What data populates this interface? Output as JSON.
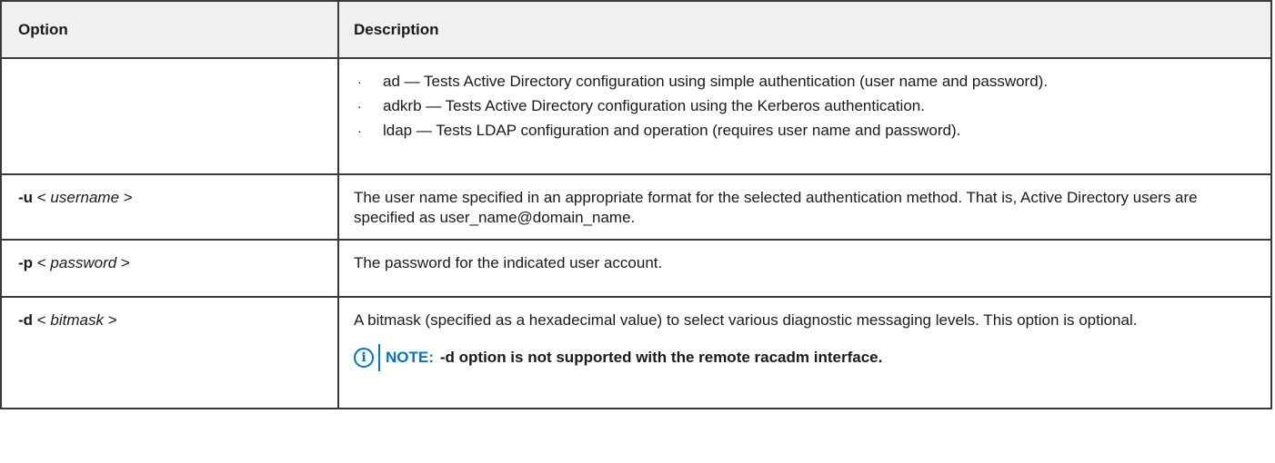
{
  "header": {
    "option_label": "Option",
    "description_label": "Description"
  },
  "rows": {
    "bullets": {
      "items": [
        "ad — Tests Active Directory configuration using simple authentication (user name and password).",
        "adkrb — Tests Active Directory configuration using the Kerberos authentication.",
        "ldap — Tests LDAP configuration and operation (requires user name and password)."
      ]
    },
    "u": {
      "flag": "-u",
      "open": " < ",
      "arg": "username",
      "close": " >",
      "description": "The user name specified in an appropriate format for the selected authentication method. That is, Active Directory users are specified as user_name@domain_name."
    },
    "p": {
      "flag": "-p",
      "open": " < ",
      "arg": "password",
      "close": " >",
      "description": "The password for the indicated user account."
    },
    "d": {
      "flag": "-d",
      "open": " < ",
      "arg": "bitmask",
      "close": " >",
      "description": "A bitmask (specified as a hexadecimal value) to select various diagnostic messaging levels. This option is optional.",
      "note_label": "NOTE:",
      "note_text": "-d option is not supported with the remote racadm interface."
    }
  },
  "bullet_glyph": "·",
  "note_icon": "info-icon",
  "colors": {
    "accent": "#0076ce",
    "header_bg": "#f0f0f0",
    "border": "#3a3a3a"
  }
}
